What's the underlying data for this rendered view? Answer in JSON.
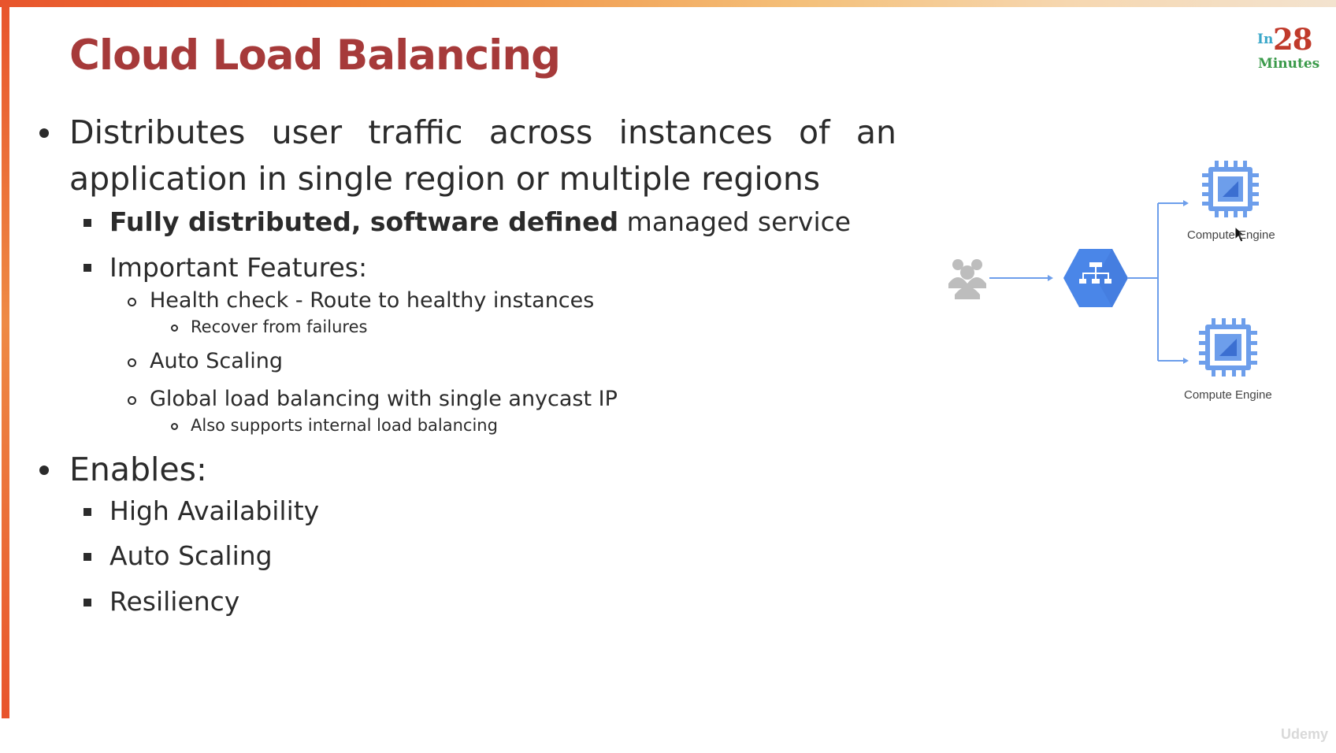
{
  "slide": {
    "title": "Cloud Load Balancing",
    "logo": {
      "prefix": "In",
      "number": "28",
      "word": "Minutes"
    },
    "bullets": {
      "b1": {
        "words": [
          "Distributes",
          "user",
          "traffic",
          "across",
          "instances",
          "of",
          "an"
        ],
        "line2": "application in single region or multiple regions",
        "sub1_bold": "Fully distributed, software defined",
        "sub1_rest": " managed service",
        "sub2": "Important Features:",
        "f1": "Health check - Route to healthy instances",
        "f1a": "Recover from failures",
        "f2": "Auto Scaling",
        "f3": "Global load balancing with single anycast IP",
        "f3a": "Also supports internal load balancing"
      },
      "b2": {
        "label": "Enables:",
        "items": [
          "High Availability",
          "Auto Scaling",
          "Resiliency"
        ]
      }
    },
    "diagram": {
      "top_label": "Compute Engine",
      "bottom_label": "Compute Engine",
      "colors": {
        "lb": "#4a86e8",
        "chip": "#6d9eeb",
        "chip_dark": "#3b6fd1",
        "line": "#6d9eeb",
        "users": "#bdbdbd"
      }
    },
    "watermark": "Udemy"
  }
}
